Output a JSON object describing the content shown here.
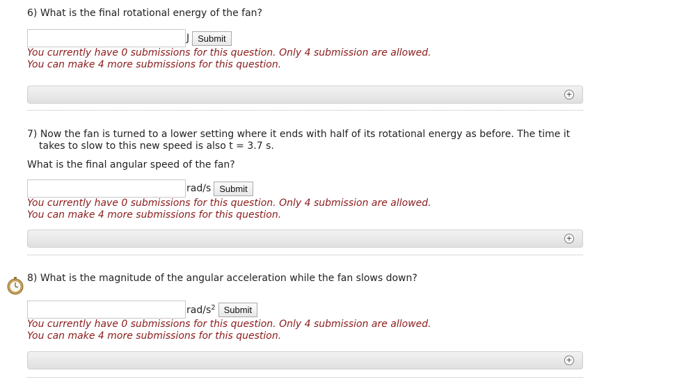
{
  "questions": [
    {
      "number_text": "6) What is the final rotational energy of the fan?",
      "unit": "J",
      "input_value": "",
      "submit_label": "Submit",
      "notice_line1": "You currently have 0 submissions for this question. Only 4 submission are allowed.",
      "notice_line2": "You can make 4 more submissions for this question."
    },
    {
      "number_text": "7) Now the fan is turned to a lower setting where it ends with half of its rotational energy as before. The time it takes to slow to this new speed is also t = 3.7 s.",
      "sub_text": "What is the final angular speed of the fan?",
      "unit": "rad/s",
      "input_value": "",
      "submit_label": "Submit",
      "notice_line1": "You currently have 0 submissions for this question. Only 4 submission are allowed.",
      "notice_line2": "You can make 4 more submissions for this question."
    },
    {
      "number_text": "8) What is the magnitude of the angular acceleration while the fan slows down?",
      "unit": "rad/s",
      "unit_superscript": "2",
      "input_value": "",
      "submit_label": "Submit",
      "notice_line1": "You currently have 0 submissions for this question. Only 4 submission are allowed.",
      "notice_line2": "You can make 4 more submissions for this question."
    }
  ],
  "expand_icon": "plus-circle-icon",
  "timer_icon": "stopwatch-icon",
  "colors": {
    "notice": "#8b1a1a",
    "bar": "#e6e6e6"
  }
}
